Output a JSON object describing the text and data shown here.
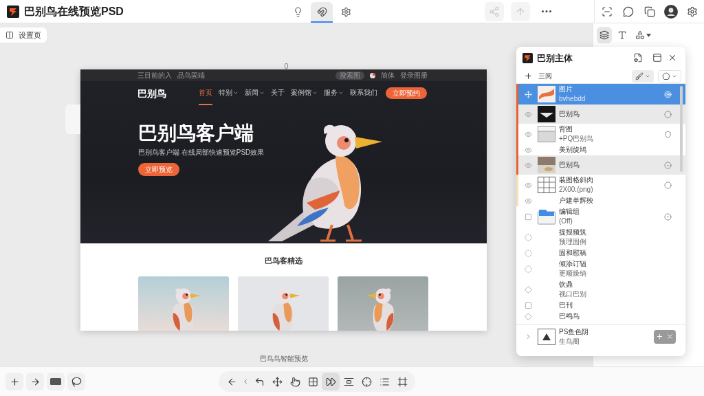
{
  "app": {
    "title": "巴别鸟在线预览PSD"
  },
  "top_tools": [
    {
      "kind": "bulb",
      "selected": false
    },
    {
      "kind": "magnet",
      "selected": true
    },
    {
      "kind": "gear",
      "selected": false
    }
  ],
  "top_actions": [
    {
      "kind": "share",
      "disabled": true
    },
    {
      "kind": "upload",
      "disabled": true
    },
    {
      "kind": "more",
      "disabled": false
    }
  ],
  "account_tools": [
    {
      "kind": "scan"
    },
    {
      "kind": "chat"
    },
    {
      "kind": "copy"
    },
    {
      "kind": "avatar"
    },
    {
      "kind": "gear"
    }
  ],
  "page_chip": {
    "label": "设置页"
  },
  "panel_tools": [
    {
      "kind": "layers",
      "selected": true,
      "menu": false
    },
    {
      "kind": "text",
      "selected": false,
      "menu": false
    },
    {
      "kind": "shape",
      "selected": false,
      "menu": true
    }
  ],
  "preview": {
    "topbar": {
      "links": [
        "三目前的入",
        "品鸟固端"
      ],
      "search": "搜索图",
      "language": "简体",
      "login": "登录图册"
    },
    "brand": "巴别鸟",
    "nav": [
      {
        "label": "首页",
        "selected": true,
        "has_menu": false
      },
      {
        "label": "特别",
        "selected": false,
        "has_menu": true
      },
      {
        "label": "新闻",
        "selected": false,
        "has_menu": true
      },
      {
        "label": "关于",
        "selected": false,
        "has_menu": false
      },
      {
        "label": "案例馆",
        "selected": false,
        "has_menu": true
      },
      {
        "label": "服务",
        "selected": false,
        "has_menu": true
      },
      {
        "label": "联系我们",
        "selected": false,
        "has_menu": false
      }
    ],
    "cta": "立即预约",
    "hero": {
      "title": "巴别鸟客户端",
      "subtitle": "巴别鸟客户端 在线局部快速预览PSD效果",
      "button": "立即预览"
    },
    "section_title": "巴鸟客精选"
  },
  "canvas_caption": "巴鸟鸟智能预览",
  "layers_panel": {
    "title": "巴别主体",
    "filter_label": "三阅",
    "layers": [
      {
        "name": "图片",
        "detail": "bvhebdd",
        "selected": true,
        "highlighted": false,
        "color": "#e8622f"
      },
      {
        "name": "巴别鸟",
        "selected": false,
        "highlighted": true,
        "color": "#e8622f"
      },
      {
        "name": "背图",
        "detail": "+PQ巴别鸟",
        "selected": false,
        "highlighted": false,
        "color": "#e8622f"
      },
      {
        "name": "美别旋鸠",
        "selected": false,
        "highlighted": false,
        "color": "#e8622f"
      },
      {
        "name": "巴别鸟",
        "selected": false,
        "highlighted": true,
        "color": "#e8622f"
      },
      {
        "name": "装图格斜肉",
        "detail": "2X00.(png)",
        "selected": false,
        "highlighted": false,
        "color": "#f6dfb3"
      },
      {
        "name": "户建单辉殃",
        "selected": false,
        "highlighted": false,
        "color": "#f6dfb3"
      },
      {
        "name": "编辑组",
        "detail": "(Off)",
        "selected": false,
        "highlighted": false
      },
      {
        "name": "提报频筑",
        "detail": "预理固例",
        "selected": false,
        "highlighted": false
      },
      {
        "name": "固和慰稿",
        "selected": false,
        "highlighted": false
      },
      {
        "name": "倾添订辐",
        "detail": "更顺燥纳",
        "selected": false,
        "highlighted": false
      },
      {
        "name": "饮鼎",
        "detail": "视口巴别",
        "selected": false,
        "highlighted": false
      },
      {
        "name": "巴刊",
        "selected": false,
        "highlighted": false
      },
      {
        "name": "巴鸣鸟",
        "selected": false,
        "highlighted": false
      }
    ],
    "footer_layer": {
      "name": "PS鱼色阴",
      "detail": "生鸟阁"
    }
  },
  "bottom_left_tools": [
    {
      "kind": "add"
    },
    {
      "kind": "arrow"
    },
    {
      "kind": "rect"
    },
    {
      "kind": "lasso"
    }
  ],
  "bottom_tools": [
    {
      "kind": "back",
      "selected": false
    },
    {
      "kind": "chevron",
      "selected": false
    },
    {
      "kind": "undo",
      "selected": false
    },
    {
      "kind": "move",
      "selected": false
    },
    {
      "kind": "pointer",
      "selected": false
    },
    {
      "kind": "grid",
      "selected": false
    },
    {
      "kind": "play",
      "selected": true
    },
    {
      "kind": "spacing",
      "selected": false
    },
    {
      "kind": "crosshair",
      "selected": false
    },
    {
      "kind": "list",
      "selected": false
    },
    {
      "kind": "frame",
      "selected": false
    }
  ]
}
